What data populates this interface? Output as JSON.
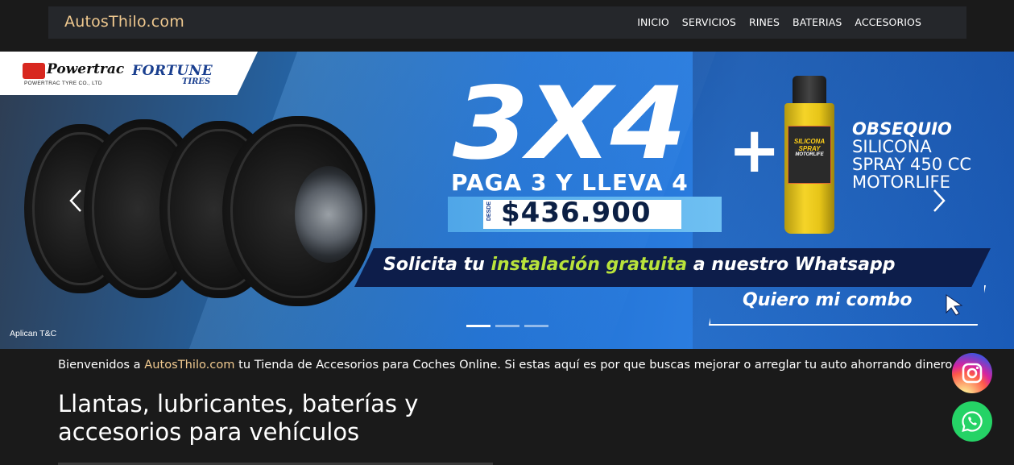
{
  "nav": {
    "brand": "AutosThilo.com",
    "items": [
      {
        "label": "INICIO"
      },
      {
        "label": "SERVICIOS"
      },
      {
        "label": "RINES"
      },
      {
        "label": "BATERIAS"
      },
      {
        "label": "ACCESORIOS"
      }
    ]
  },
  "banner": {
    "logos": {
      "powertrac": "Powertrac",
      "powertrac_sub": "POWERTRAC TYRE CO., LTD",
      "fortune": "FORTUNE",
      "fortune_sub": "TIRES"
    },
    "headline": "3X4",
    "plus": "+",
    "subheadline": "PAGA 3 Y LLEVA 4",
    "price_prefix": "DESDE",
    "price": "$436.900",
    "spray_label": "SILICONA SPRAY",
    "spray_brand": "MOTORLIFE",
    "gift_title": "OBSEQUIO",
    "gift_lines": [
      "SILICONA",
      "SPRAY 450 CC",
      "MOTORLIFE"
    ],
    "whatsapp_text_before": "Solicita tu ",
    "whatsapp_text_highlight": "instalación gratuita",
    "whatsapp_text_after": " a nuestro Whatsapp",
    "cta": "Quiero mi combo",
    "terms": "Aplican T&C",
    "slides_count": 3,
    "active_slide": 1
  },
  "content": {
    "welcome_before": "Bienvenidos a ",
    "welcome_brand": "AutosThilo.com",
    "welcome_after": " tu Tienda de Accesorios para Coches Online. Si estas aquí es por que buscas mejorar o arreglar tu auto ahorrando dinero.",
    "heading_line1": "Llantas, lubricantes, baterías y",
    "heading_line2": "accesorios para vehículos"
  },
  "icons": {
    "prev": "chevron-left-icon",
    "next": "chevron-right-icon",
    "instagram": "instagram-icon",
    "whatsapp": "whatsapp-icon",
    "cursor": "cursor-arrow-icon"
  },
  "colors": {
    "brand": "#f0c98f",
    "nav_bg": "#25272b",
    "page_bg": "#1a1a1a",
    "highlight": "#b9e33b",
    "whatsapp": "#25d366"
  }
}
